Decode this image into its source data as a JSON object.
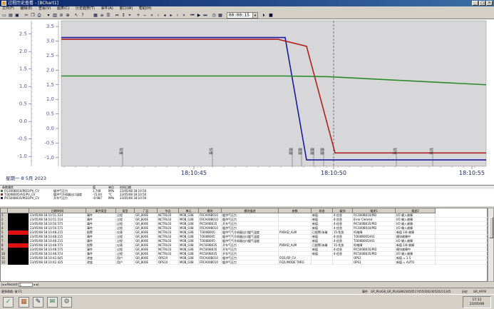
{
  "window": {
    "title": "过程历史查看 - [BChart1]",
    "min": "_",
    "max": "□",
    "close": "×"
  },
  "menu": [
    "文件(F)",
    "编辑(E)",
    "查看(V)",
    "图表(C)",
    "历史趋势(T)",
    "事件(A)",
    "窗口(W)",
    "帮助(H)"
  ],
  "toolbar": {
    "time_value": "00:00:15"
  },
  "chart_data": {
    "type": "line",
    "x_ticks": [
      "18:10:45",
      "18:10:50",
      "18:10:55"
    ],
    "y_axis_left": {
      "ticks": [
        "2.5",
        "2.0",
        "1.5",
        "1.0",
        "0.5",
        "0.0",
        "-0.5",
        "-1.0"
      ],
      "ylim": [
        -1.2,
        2.8
      ]
    },
    "y_axis_right": {
      "ticks": [
        "3.5",
        "3.0",
        "2.5",
        "2.0",
        "1.5",
        "1.0",
        "0.5",
        "0.0",
        "-0.5",
        "-1.0"
      ],
      "ylim": [
        -1.2,
        3.6
      ]
    },
    "series": [
      {
        "color": "#1a1aa0",
        "points": [
          [
            0,
            2.4
          ],
          [
            400,
            2.4
          ],
          [
            430,
            -1.1
          ],
          [
            693,
            -1.1
          ]
        ]
      },
      {
        "color": "#b02020",
        "points": [
          [
            0,
            2.35
          ],
          [
            390,
            2.35
          ],
          [
            430,
            2.15
          ],
          [
            470,
            -0.9
          ],
          [
            693,
            -0.9
          ]
        ]
      },
      {
        "color": "#2a8a2a",
        "points": [
          [
            0,
            1.3
          ],
          [
            400,
            1.3
          ],
          [
            460,
            1.28
          ],
          [
            693,
            1.05
          ]
        ]
      }
    ],
    "event_markers": [
      {
        "x": 172,
        "label": "事件"
      },
      {
        "x": 298,
        "label": "事件"
      },
      {
        "x": 410,
        "label": "报警"
      },
      {
        "x": 423,
        "label": "报警"
      },
      {
        "x": 440,
        "label": "报警"
      },
      {
        "x": 454,
        "label": "报警"
      },
      {
        "x": 556,
        "label": "事件"
      },
      {
        "x": 607,
        "label": "事件"
      }
    ],
    "cursor_x": 468,
    "date_label": "星期一 8 5月 2023"
  },
  "legend": {
    "headers": [
      "参数属性",
      "值",
      "单位",
      "时间日期"
    ],
    "rows": [
      {
        "color": "#2a8a2a",
        "tag": "FIC400B010/PID1/PV_CV",
        "desc": "缓冲气压力",
        "value": "1.748",
        "unit": "MPa",
        "time": "23/05/08 18:10:50"
      },
      {
        "color": "#b02020",
        "tag": "TI300B005/AI1/PV_CV",
        "desc": "缓冲气冷却器出口温度",
        "value": "-72.04",
        "unit": "°C",
        "time": "23/05/08 18:10:50"
      },
      {
        "color": "#1a1aa0",
        "tag": "PIC500B035/PID1/PV_CV",
        "desc": "开车气压力",
        "value": "-0.987",
        "unit": "MPa",
        "time": "23/05/08 18:10:50"
      }
    ]
  },
  "grid": {
    "headers": [
      "",
      "",
      "日期/时间",
      "事件类型",
      "类型",
      "厂区",
      "节点",
      "单元",
      "模块",
      "模块描述",
      "参数",
      "状态",
      "级别",
      "描述1",
      "描述2"
    ],
    "rows": [
      [
        "1",
        "",
        "23/05/08 18:10:51.514",
        "事件",
        "过程",
        "GR_800E",
        "NCTRL03",
        "MOB_G08",
        "FRCA00B010",
        "缓冲气压力",
        "",
        "新值",
        "4-信息",
        "FIC400B010/PID",
        "I/O 输入故障"
      ],
      [
        "2",
        "",
        "23/05/08 18:10:51.514",
        "事件",
        "过程",
        "GR_800E",
        "NCTRL03",
        "MOB_G08",
        "FRCA00B010",
        "缓冲气压力",
        "",
        "新值",
        "4-信息",
        "Error Cleared",
        "I/O 输入故障"
      ],
      [
        "3",
        "",
        "23/05/08 18:10:50.575",
        "事件",
        "过程",
        "GR_800E",
        "NCTRL03",
        "MOB_G08",
        "PIC500B035",
        "开车气压力",
        "",
        "新值",
        "4-信息",
        "PIC500B035/PID",
        "I/O 输入故障"
      ],
      [
        "4",
        "",
        "23/05/08 18:10:50.575",
        "事件",
        "过程",
        "GR_800E",
        "NCTRL03",
        "MOB_G08",
        "FRCA00B010",
        "缓冲气压力",
        "",
        "新值",
        "4-信息",
        "FIC400B010/PID",
        "I/O 输入故障"
      ],
      [
        "5",
        "red",
        "23/05/08 18:10:48.215",
        "报警",
        "仪表",
        "GR_800E",
        "NCTRL03",
        "MOB_G08",
        "TI300B005",
        "缓冲气气冷却器出口缓气温度",
        "PVBAD_ALM",
        "已报警/未确",
        "15-危急",
        "IO故障",
        "新值 1/8 故障"
      ],
      [
        "6",
        "",
        "23/05/08 18:10:48.215",
        "事件",
        "过程",
        "GR_800E",
        "NCTRL03",
        "MOB_G08",
        "TI300B005",
        "缓冲气气冷却器出口缓气温度",
        "",
        "新值",
        "4-信息",
        "TI300B005/AI1",
        "模块故障中"
      ],
      [
        "7",
        "",
        "23/05/08 18:10:48.215",
        "事件",
        "过程",
        "GR_800E",
        "NCTRL03",
        "MOB_G08",
        "TI300B005",
        "缓冲气气冷却器出口缓气温度",
        "",
        "新值",
        "4-信息",
        "TI300B005/AI1",
        "I/O 输入故障"
      ],
      [
        "8",
        "red",
        "23/05/08 18:10:48.575",
        "报警",
        "仪表",
        "GR_800E",
        "NCTRL03",
        "MOB_G08",
        "PIC500B035",
        "开车气压力",
        "PVBAD_ALM",
        "已报警/未确",
        "15-危急",
        "IO故障",
        "新值 1/8 故障"
      ],
      [
        "9",
        "",
        "23/05/08 18:10:48.575",
        "事件",
        "过程",
        "GR_800E",
        "NCTRL03",
        "MOB_G08",
        "PIC500B035",
        "开车气压力",
        "",
        "新值",
        "4-信息",
        "PIC500B035/PID",
        "模块故障中"
      ],
      [
        "10",
        "",
        "23/05/08 18:10:48.574",
        "事件",
        "过程",
        "GR_800E",
        "NCTRL03",
        "MOB_G08",
        "PIC500B035",
        "开车气压力",
        "",
        "新值",
        "4-信息",
        "PIC500B035/PID",
        "I/O 输入故障"
      ],
      [
        "11",
        "",
        "23/05/08 18:10:42.645",
        "改变",
        "用户",
        "GR_800E",
        "OPS10",
        "MOB_G08",
        "FRCA00B010",
        "缓冲气压力",
        "FID1/SP_CV",
        "",
        "",
        "OPS1",
        "新值 = 1.5"
      ],
      [
        "12",
        "",
        "23/05/08 18:10:42.425",
        "改变",
        "用户",
        "GR_800E",
        "OPS10",
        "MOB_G08",
        "FRCA00B010",
        "缓冲气压力",
        "FID1/MODE TARG",
        "",
        "",
        "OPS1",
        "新值 = AUTO"
      ]
    ]
  },
  "nav": {
    "label": "Record:",
    "value": "1"
  },
  "status": {
    "left": "更多帮助: 按 F1",
    "mid": "事件",
    "right_text": "GR_PLUG8_GR_PLUG8023050517455026230520211345",
    "label2": "历史",
    "right2": "GR_AFF8"
  },
  "clock": {
    "time": "17:11",
    "date": "23/05/08"
  }
}
